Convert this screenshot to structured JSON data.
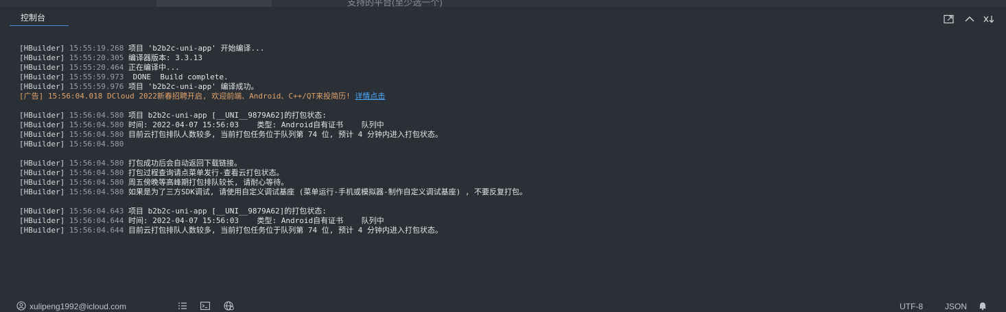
{
  "topstrip": {
    "ghost_text": "支持的平台(至少选一个)"
  },
  "panel": {
    "tab_label": "控制台",
    "icons": [
      "open-in-new-window-icon",
      "collapse-up-icon",
      "clear-console-icon"
    ]
  },
  "log": [
    {
      "tag": "[HBuilder]",
      "ts": "15:55:19.268",
      "msg": "项目 'b2b2c-uni-app' 开始编译..."
    },
    {
      "tag": "[HBuilder]",
      "ts": "15:55:20.305",
      "msg": "编译器版本: 3.3.13"
    },
    {
      "tag": "[HBuilder]",
      "ts": "15:55:20.464",
      "msg": "正在编译中..."
    },
    {
      "tag": "[HBuilder]",
      "ts": "15:55:59.973",
      "msg": " DONE  Build complete."
    },
    {
      "tag": "[HBuilder]",
      "ts": "15:55:59.976",
      "msg": "项目 'b2b2c-uni-app' 编译成功。"
    },
    {
      "ad": true,
      "tag": "[广告]",
      "ts": "15:56:04.018",
      "msg": "DCloud 2022新春招聘开启, 欢迎前端、Android、C++/QT来投简历!",
      "link": "详情点击"
    },
    {
      "blank": true
    },
    {
      "tag": "[HBuilder]",
      "ts": "15:56:04.580",
      "msg": "项目 b2b2c-uni-app [__UNI__9879A62]的打包状态:"
    },
    {
      "tag": "[HBuilder]",
      "ts": "15:56:04.580",
      "msg": "时间: 2022-04-07 15:56:03    类型: Android自有证书    队列中"
    },
    {
      "tag": "[HBuilder]",
      "ts": "15:56:04.580",
      "msg": "目前云打包排队人数较多, 当前打包任务位于队列第 74 位, 预计 4 分钟内进入打包状态。"
    },
    {
      "tag": "[HBuilder]",
      "ts": "15:56:04.580",
      "msg": ""
    },
    {
      "blank": true
    },
    {
      "tag": "[HBuilder]",
      "ts": "15:56:04.580",
      "msg": "打包成功后会自动返回下载链接。"
    },
    {
      "tag": "[HBuilder]",
      "ts": "15:56:04.580",
      "msg": "打包过程查询请点菜单发行-查看云打包状态。"
    },
    {
      "tag": "[HBuilder]",
      "ts": "15:56:04.580",
      "msg": "周五傍晚等高峰期打包排队较长, 请耐心等待。"
    },
    {
      "tag": "[HBuilder]",
      "ts": "15:56:04.580",
      "msg": "如果是为了三方SDK调试, 请使用自定义调试基座 (菜单运行-手机或模拟器-制作自定义调试基座) , 不要反复打包。"
    },
    {
      "blank": true
    },
    {
      "tag": "[HBuilder]",
      "ts": "15:56:04.643",
      "msg": "项目 b2b2c-uni-app [__UNI__9879A62]的打包状态:"
    },
    {
      "tag": "[HBuilder]",
      "ts": "15:56:04.644",
      "msg": "时间: 2022-04-07 15:56:03    类型: Android自有证书    队列中"
    },
    {
      "tag": "[HBuilder]",
      "ts": "15:56:04.644",
      "msg": "目前云打包排队人数较多, 当前打包任务位于队列第 74 位, 预计 4 分钟内进入打包状态。"
    }
  ],
  "statusbar": {
    "user_email": "xulipeng1992@icloud.com",
    "encoding": "UTF-8",
    "language": "JSON",
    "icons": [
      "user-icon",
      "list-icon",
      "terminal-icon",
      "globe-icon",
      "bell-icon"
    ]
  }
}
